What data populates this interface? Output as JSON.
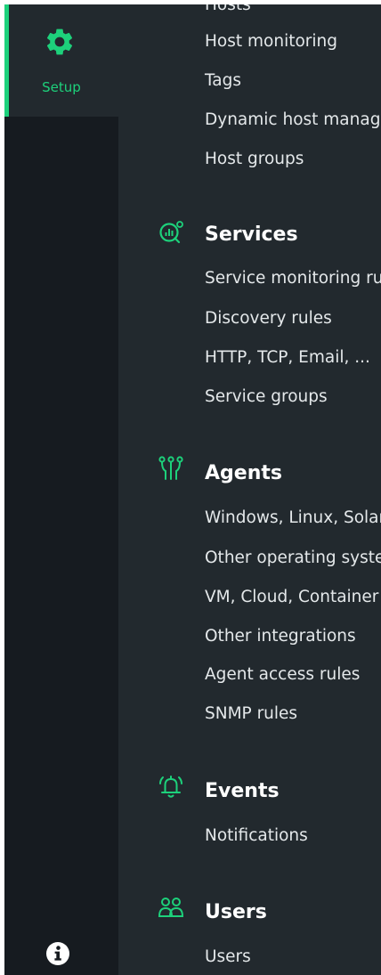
{
  "sidebar": {
    "setup_label": "Setup",
    "setup_icon": "gear-icon",
    "info_icon": "info-icon",
    "accent": "#1dd17b"
  },
  "menu": {
    "hosts": {
      "cut_title": "Hosts",
      "items": [
        "Host monitoring",
        "Tags",
        "Dynamic host management",
        "Host groups"
      ]
    },
    "services": {
      "title": "Services",
      "icon": "service-monitor-icon",
      "items": [
        "Service monitoring rules",
        "Discovery rules",
        "HTTP, TCP, Email, ...",
        "Service groups"
      ]
    },
    "agents": {
      "title": "Agents",
      "icon": "agents-icon",
      "items": [
        "Windows, Linux, Solaris, AIX",
        "Other operating systems",
        "VM, Cloud, Container",
        "Other integrations",
        "Agent access rules",
        "SNMP rules"
      ]
    },
    "events": {
      "title": "Events",
      "icon": "bell-icon",
      "items": [
        "Notifications"
      ]
    },
    "users": {
      "title": "Users",
      "icon": "users-icon",
      "items": [
        "Users"
      ]
    }
  }
}
